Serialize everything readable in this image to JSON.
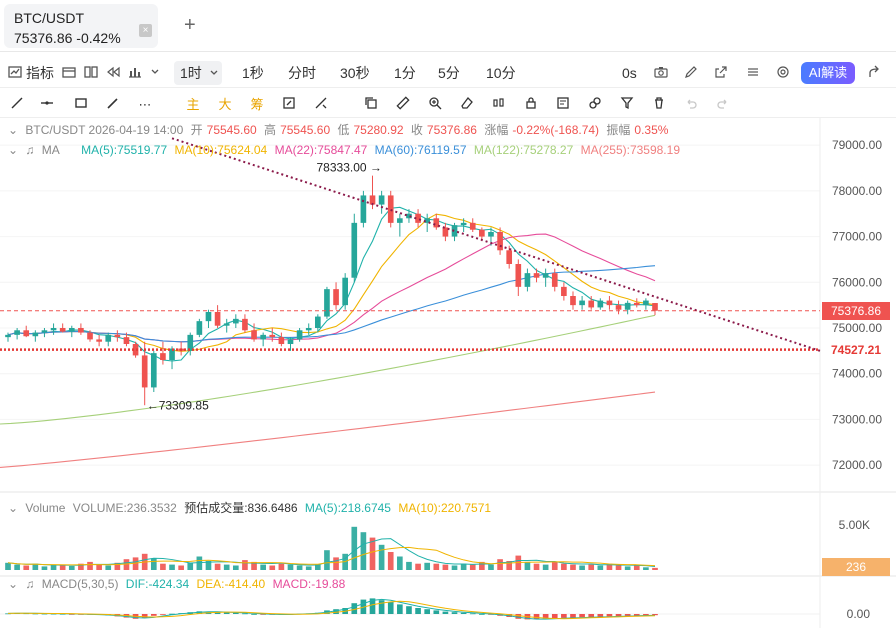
{
  "tab": {
    "symbol": "BTC/USDT",
    "price_change": "75376.86  -0.42%",
    "close_glyph": "×",
    "add_glyph": "+"
  },
  "toolbar": {
    "indicator_label": "指标",
    "active_interval": "1时",
    "intervals": [
      "1秒",
      "分时",
      "30秒",
      "1分",
      "5分",
      "10分"
    ],
    "zero_s": "0s",
    "ai_label": "AI解读"
  },
  "drawing_tools": {
    "zhu": "主",
    "da": "大",
    "chou": "筹"
  },
  "ohlc": {
    "prefix": "BTC/USDT  2026-04-19 14:00",
    "open_label": "开",
    "open": "75545.60",
    "high_label": "高",
    "high": "75545.60",
    "low_label": "低",
    "low": "75280.92",
    "close_label": "收",
    "close": "75376.86",
    "chg_label": "涨幅",
    "chg": "-0.22%(-168.74)",
    "amp_label": "振幅",
    "amp": "0.35%"
  },
  "ma_legend": {
    "label": "MA",
    "ma5": "MA(5):75519.77",
    "ma10": "MA(10):75624.04",
    "ma22": "MA(22):75847.47",
    "ma60": "MA(60):76119.57",
    "ma122": "MA(122):75278.27",
    "ma255": "MA(255):73598.19"
  },
  "volume_legend": {
    "label": "Volume",
    "volume": "VOLUME:236.3532",
    "est": "预估成交量:836.6486",
    "ma5": "MA(5):218.6745",
    "ma10": "MA(10):220.7571"
  },
  "macd_legend": {
    "label": "MACD(5,30,5)",
    "dif": "DIF:-424.34",
    "dea": "DEA:-414.40",
    "macd": "MACD:-19.88"
  },
  "price_axis": {
    "ticks": [
      "79000.00",
      "78000.00",
      "77000.00",
      "76000.00",
      "75000.00",
      "74000.00",
      "73000.00",
      "72000.00"
    ],
    "current_price": "75376.86",
    "line_price": "74527.21",
    "high_annotation": "78333.00 →",
    "low_annotation": "←73309.85"
  },
  "volume_axis": {
    "tick": "5.00K",
    "current": "236"
  },
  "macd_axis": {
    "tick": "0.00"
  },
  "colors": {
    "up": "#26a69a",
    "down": "#ef5350",
    "ma5": "#20b2aa",
    "ma10": "#f0b400",
    "ma22": "#e64c9a",
    "ma60": "#3a8fd9",
    "ma122": "#a6d07a",
    "ma255": "#f08080",
    "trendline": "#8b1a4a",
    "hline": "#e53935"
  },
  "chart_data": {
    "type": "candlestick",
    "interval": "1h",
    "candles": [
      [
        74800,
        74900,
        74700,
        74850
      ],
      [
        74850,
        75000,
        74750,
        74950
      ],
      [
        74950,
        75050,
        74800,
        74820
      ],
      [
        74820,
        74950,
        74700,
        74900
      ],
      [
        74900,
        75000,
        74800,
        74950
      ],
      [
        74950,
        75100,
        74850,
        75000
      ],
      [
        75000,
        75100,
        74900,
        74920
      ],
      [
        74920,
        75050,
        74800,
        75000
      ],
      [
        75000,
        75100,
        74850,
        74900
      ],
      [
        74900,
        74950,
        74700,
        74750
      ],
      [
        74750,
        74850,
        74600,
        74700
      ],
      [
        74700,
        74900,
        74600,
        74850
      ],
      [
        74850,
        74950,
        74700,
        74800
      ],
      [
        74800,
        74900,
        74600,
        74650
      ],
      [
        74650,
        74700,
        74350,
        74400
      ],
      [
        74400,
        74700,
        73310,
        73700
      ],
      [
        73700,
        74500,
        73600,
        74450
      ],
      [
        74450,
        74700,
        74200,
        74300
      ],
      [
        74300,
        74600,
        74100,
        74550
      ],
      [
        74550,
        74700,
        74400,
        74500
      ],
      [
        74500,
        74900,
        74400,
        74850
      ],
      [
        74850,
        75200,
        74800,
        75150
      ],
      [
        75150,
        75400,
        75000,
        75350
      ],
      [
        75350,
        75500,
        75000,
        75050
      ],
      [
        75050,
        75200,
        74900,
        75100
      ],
      [
        75100,
        75300,
        75000,
        75200
      ],
      [
        75200,
        75300,
        74900,
        74950
      ],
      [
        74950,
        75100,
        74700,
        74750
      ],
      [
        74750,
        74900,
        74600,
        74850
      ],
      [
        74850,
        75000,
        74700,
        74800
      ],
      [
        74800,
        74900,
        74600,
        74650
      ],
      [
        74650,
        74800,
        74500,
        74750
      ],
      [
        74750,
        75000,
        74700,
        74950
      ],
      [
        74950,
        75100,
        74850,
        75000
      ],
      [
        75000,
        75300,
        74900,
        75250
      ],
      [
        75250,
        75900,
        75200,
        75850
      ],
      [
        75850,
        76000,
        75400,
        75500
      ],
      [
        75500,
        76200,
        75400,
        76100
      ],
      [
        76100,
        77500,
        76000,
        77300
      ],
      [
        77300,
        78000,
        77200,
        77900
      ],
      [
        77900,
        78333,
        77600,
        77700
      ],
      [
        77700,
        78000,
        77500,
        77900
      ],
      [
        77900,
        78000,
        77200,
        77300
      ],
      [
        77300,
        77500,
        77000,
        77400
      ],
      [
        77400,
        77600,
        77300,
        77500
      ],
      [
        77500,
        77600,
        77200,
        77300
      ],
      [
        77300,
        77500,
        77100,
        77400
      ],
      [
        77400,
        77500,
        77150,
        77200
      ],
      [
        77200,
        77300,
        76900,
        77000
      ],
      [
        77000,
        77300,
        76900,
        77250
      ],
      [
        77250,
        77400,
        77100,
        77300
      ],
      [
        77300,
        77400,
        77100,
        77150
      ],
      [
        77150,
        77200,
        76900,
        77000
      ],
      [
        77000,
        77200,
        76800,
        77100
      ],
      [
        77100,
        77200,
        76600,
        76700
      ],
      [
        76700,
        76800,
        76300,
        76400
      ],
      [
        76400,
        76500,
        75700,
        75900
      ],
      [
        75900,
        76300,
        75800,
        76200
      ],
      [
        76200,
        76300,
        76000,
        76100
      ],
      [
        76100,
        76300,
        75900,
        76200
      ],
      [
        76200,
        76300,
        75800,
        75900
      ],
      [
        75900,
        76000,
        75600,
        75700
      ],
      [
        75700,
        75800,
        75400,
        75500
      ],
      [
        75500,
        75700,
        75400,
        75600
      ],
      [
        75600,
        75700,
        75400,
        75450
      ],
      [
        75450,
        75650,
        75400,
        75600
      ],
      [
        75600,
        75700,
        75400,
        75500
      ],
      [
        75500,
        75600,
        75300,
        75400
      ],
      [
        75400,
        75600,
        75300,
        75550
      ],
      [
        75550,
        75650,
        75450,
        75500
      ],
      [
        75500,
        75650,
        75400,
        75600
      ],
      [
        75546,
        75546,
        75281,
        75377
      ]
    ],
    "volume_max": 6000,
    "volumes": [
      800,
      600,
      500,
      700,
      400,
      600,
      500,
      450,
      700,
      900,
      600,
      500,
      800,
      1200,
      1400,
      1800,
      1300,
      700,
      600,
      500,
      800,
      1500,
      1000,
      700,
      600,
      500,
      1100,
      900,
      600,
      500,
      700,
      600,
      500,
      400,
      600,
      2200,
      1400,
      1800,
      4800,
      4200,
      3600,
      2800,
      2000,
      1500,
      900,
      700,
      800,
      700,
      600,
      500,
      700,
      600,
      900,
      600,
      1200,
      1000,
      1600,
      900,
      700,
      600,
      900,
      700,
      600,
      500,
      600,
      500,
      700,
      500,
      400,
      500,
      300,
      236
    ],
    "macd": [
      10,
      15,
      12,
      8,
      6,
      5,
      3,
      -2,
      -5,
      -10,
      -15,
      -25,
      -40,
      -60,
      -80,
      -60,
      -30,
      -10,
      5,
      15,
      30,
      45,
      40,
      30,
      25,
      20,
      10,
      0,
      -5,
      -10,
      -8,
      -5,
      5,
      10,
      20,
      60,
      80,
      100,
      180,
      240,
      260,
      230,
      200,
      160,
      130,
      100,
      80,
      60,
      40,
      30,
      20,
      10,
      0,
      -10,
      -30,
      -50,
      -80,
      -90,
      -85,
      -80,
      -70,
      -65,
      -60,
      -55,
      -50,
      -45,
      -40,
      -35,
      -30,
      -25,
      -22,
      -20
    ],
    "ylim": [
      71500,
      79200
    ],
    "current_price": 75376.86,
    "hline_price": 74527.21,
    "high": 78333.0,
    "low": 73309.85
  }
}
